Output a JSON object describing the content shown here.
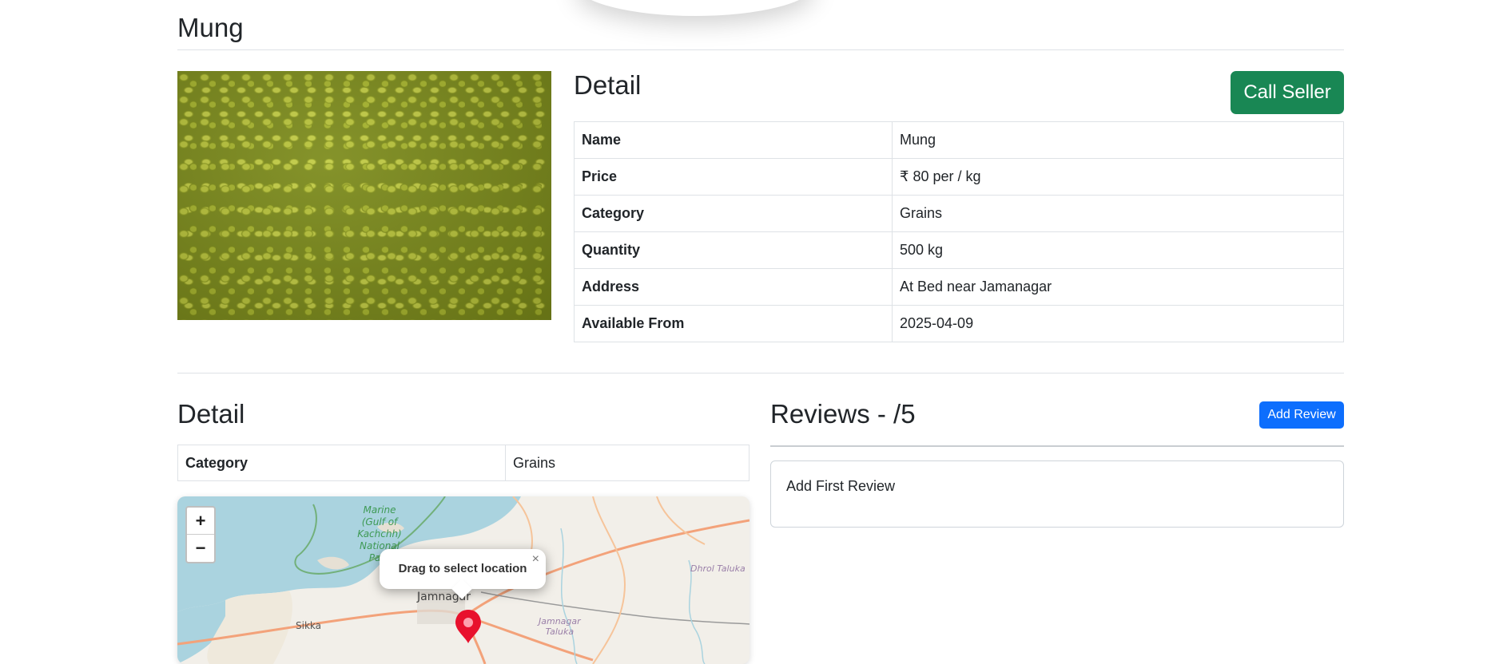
{
  "page": {
    "title": "Mung"
  },
  "product": {
    "image_alt": "Mung beans",
    "detail_heading": "Detail",
    "call_button": "Call Seller",
    "rows": [
      {
        "key": "Name",
        "value": "Mung"
      },
      {
        "key": "Price",
        "value": "₹ 80 per / kg"
      },
      {
        "key": "Category",
        "value": "Grains"
      },
      {
        "key": "Quantity",
        "value": "500 kg"
      },
      {
        "key": "Address",
        "value": "At Bed near Jamanagar"
      },
      {
        "key": "Available From",
        "value": "2025-04-09"
      }
    ]
  },
  "detail2": {
    "heading": "Detail",
    "rows": [
      {
        "key": "Category",
        "value": "Grains"
      }
    ]
  },
  "map": {
    "zoom_in": "+",
    "zoom_out": "−",
    "popup_text": "Drag to select location",
    "popup_close": "×",
    "labels": {
      "marine": [
        "Marine",
        "(Gulf of",
        "Kachchh)",
        "National",
        "Park"
      ],
      "jamnagar": "Jamnagar",
      "sikka": "Sikka",
      "dhrol": "Dhrol Taluka",
      "jamnagar_taluka": [
        "Jamnagar",
        "Taluka"
      ]
    },
    "colors": {
      "sea": "#aad3df",
      "land": "#f2efe9",
      "road": "#f3a27a",
      "marker": "#e8112d"
    }
  },
  "reviews": {
    "heading": "Reviews - /5",
    "add_button": "Add Review",
    "empty_text": "Add First Review"
  }
}
